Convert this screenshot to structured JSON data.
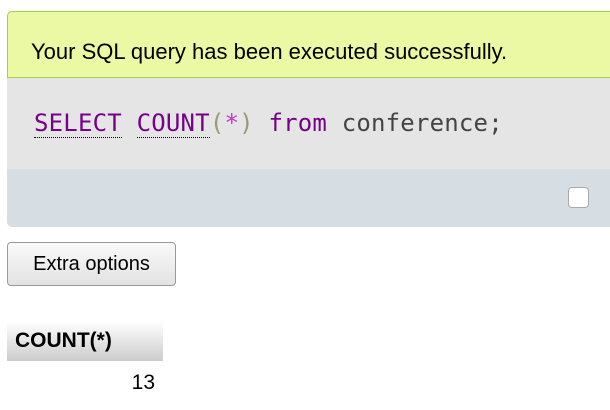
{
  "message": {
    "success_text": "Your SQL query has been executed successfully."
  },
  "sql": {
    "keyword_select": "SELECT",
    "function_count": "COUNT",
    "paren_open": "(",
    "star": "*",
    "paren_close": ")",
    "keyword_from": "from",
    "table_name": "conference",
    "terminator": ";"
  },
  "buttons": {
    "extra_options": "Extra options"
  },
  "results": {
    "columns": [
      "COUNT(*)"
    ],
    "rows": [
      [
        "13"
      ]
    ]
  },
  "colors": {
    "success_bg": "#ebf8a4",
    "success_border": "#a2d246",
    "sql_keyword": "#770088",
    "sql_star": "#cc33cc"
  }
}
